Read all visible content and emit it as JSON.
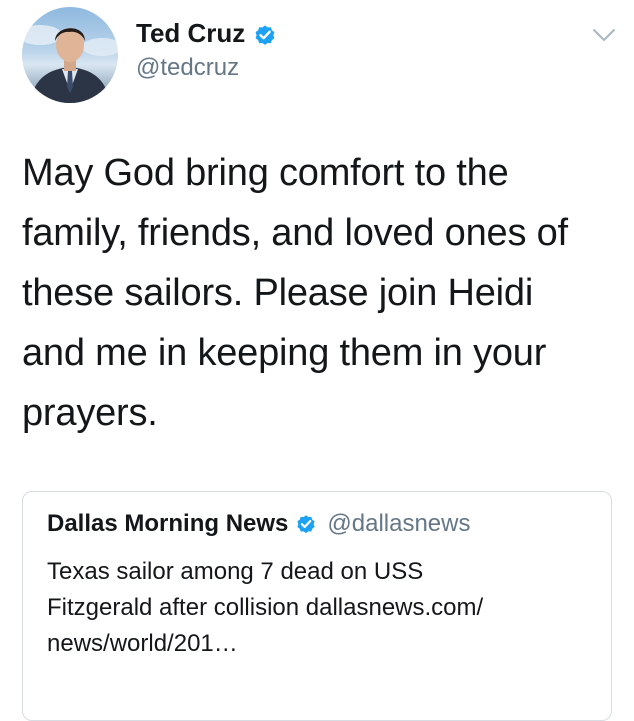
{
  "author": {
    "display_name": "Ted Cruz",
    "handle": "@tedcruz",
    "verified": true
  },
  "tweet": {
    "text": "May God bring comfort to the\nfamily, friends, and loved ones of\nthese sailors. Please join Heidi\nand me in keeping them in your\nprayers."
  },
  "quoted_tweet": {
    "display_name": "Dallas Morning News",
    "handle": "@dallasnews",
    "verified": true,
    "text": "Texas sailor among 7 dead on USS\nFitzgerald after collision dallasnews.com/\nnews/world/201…"
  },
  "colors": {
    "verified_blue": "#1da1f2",
    "text_primary": "#14171a",
    "text_secondary": "#657786",
    "border": "#d6dde3"
  },
  "icons": {
    "verified": "verified-badge-icon",
    "menu": "chevron-down-icon"
  }
}
